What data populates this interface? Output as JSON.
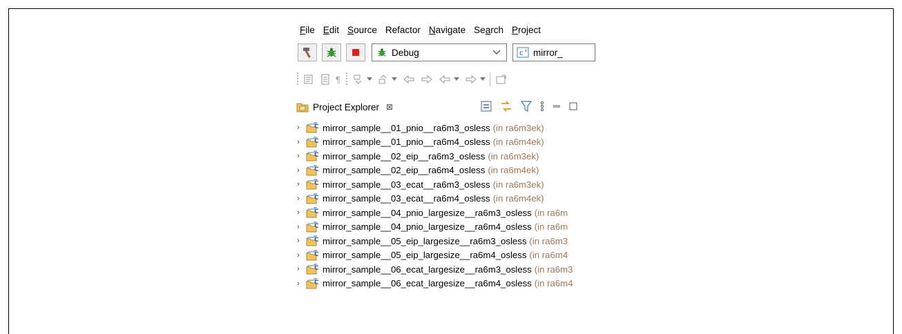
{
  "menu": [
    {
      "label": "File",
      "ul": "F",
      "rest": "ile"
    },
    {
      "label": "Edit",
      "ul": "E",
      "rest": "dit"
    },
    {
      "label": "Source",
      "ul": "S",
      "rest": "ource"
    },
    {
      "label": "Refactor",
      "ul": "",
      "rest": "Refactor"
    },
    {
      "label": "Navigate",
      "ul": "N",
      "rest": "avigate"
    },
    {
      "label": "Search",
      "pre": "Se",
      "ul": "a",
      "rest": "rch"
    },
    {
      "label": "Project",
      "ul": "P",
      "rest": "roject"
    }
  ],
  "toolbar": {
    "build_config": "Debug",
    "launch_target": "mirror_"
  },
  "project_explorer": {
    "title": "Project Explorer",
    "close_glyph": "⊠"
  },
  "projects": [
    {
      "name": "mirror_sample__01_pnio__ra6m3_osless",
      "context": "(in ra6m3ek)"
    },
    {
      "name": "mirror_sample__01_pnio__ra6m4_osless",
      "context": "(in ra6m4ek)"
    },
    {
      "name": "mirror_sample__02_eip__ra6m3_osless",
      "context": "(in ra6m3ek)"
    },
    {
      "name": "mirror_sample__02_eip__ra6m4_osless",
      "context": "(in ra6m4ek)"
    },
    {
      "name": "mirror_sample__03_ecat__ra6m3_osless",
      "context": "(in ra6m3ek)"
    },
    {
      "name": "mirror_sample__03_ecat__ra6m4_osless",
      "context": "(in ra6m4ek)"
    },
    {
      "name": "mirror_sample__04_pnio_largesize__ra6m3_osless",
      "context": "(in ra6m"
    },
    {
      "name": "mirror_sample__04_pnio_largesize__ra6m4_osless",
      "context": "(in ra6m"
    },
    {
      "name": "mirror_sample__05_eip_largesize__ra6m3_osless",
      "context": "(in ra6m3"
    },
    {
      "name": "mirror_sample__05_eip_largesize__ra6m4_osless",
      "context": "(in ra6m4"
    },
    {
      "name": "mirror_sample__06_ecat_largesize__ra6m3_osless",
      "context": "(in ra6m3"
    },
    {
      "name": "mirror_sample__06_ecat_largesize__ra6m4_osless",
      "context": "(in ra6m4"
    }
  ]
}
